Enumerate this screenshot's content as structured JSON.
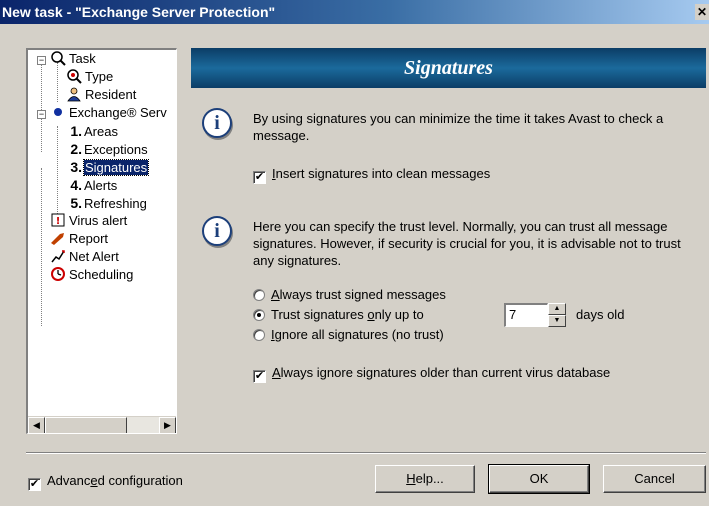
{
  "window": {
    "title": "New task - \"Exchange Server Protection\"",
    "close_glyph": "✕"
  },
  "tree": {
    "items": [
      {
        "label": "Task",
        "icon": "task-icon"
      },
      {
        "label": "Type",
        "icon": "type-icon"
      },
      {
        "label": "Resident",
        "icon": "resident-icon"
      },
      {
        "label": "Exchange® Serv",
        "icon": "exchange-dot-icon"
      },
      {
        "num": "1.",
        "label": "Areas"
      },
      {
        "num": "2.",
        "label": "Exceptions"
      },
      {
        "num": "3.",
        "label": "Signatures"
      },
      {
        "num": "4.",
        "label": "Alerts"
      },
      {
        "num": "5.",
        "label": "Refreshing"
      },
      {
        "label": "Virus alert",
        "icon": "virus-alert-icon"
      },
      {
        "label": "Report",
        "icon": "report-icon"
      },
      {
        "label": "Net Alert",
        "icon": "net-alert-icon"
      },
      {
        "label": "Scheduling",
        "icon": "clock-icon"
      }
    ],
    "selected": "Signatures"
  },
  "panel": {
    "heading": "Signatures",
    "intro_text": "By using signatures you can minimize the time it takes Avast to check a message.",
    "insert_signatures": {
      "prefix": "",
      "underlined": "I",
      "rest": "nsert signatures into clean messages",
      "checked": true
    },
    "trust_text": "Here you can specify the trust level. Normally, you can trust all message signatures. However, if security is crucial for you, it is advisable not to trust any signatures.",
    "radio_always": {
      "underlined": "A",
      "rest": "lways trust signed messages",
      "selected": false
    },
    "radio_trust_upto": {
      "before": "Trust signatures ",
      "underlined": "o",
      "rest": "nly up to",
      "selected": true
    },
    "radio_ignore": {
      "underlined": "I",
      "rest": "gnore all signatures (no trust)",
      "selected": false
    },
    "days_value": "7",
    "days_label": "days old",
    "always_ignore_older": {
      "underlined": "A",
      "rest": "lways ignore signatures older than current virus database",
      "checked": true
    }
  },
  "footer": {
    "advanced": {
      "before": "Advanc",
      "underlined": "e",
      "rest": "d configuration",
      "checked": true
    },
    "help": {
      "underlined": "H",
      "rest": "elp..."
    },
    "ok": "OK",
    "cancel": "Cancel"
  }
}
